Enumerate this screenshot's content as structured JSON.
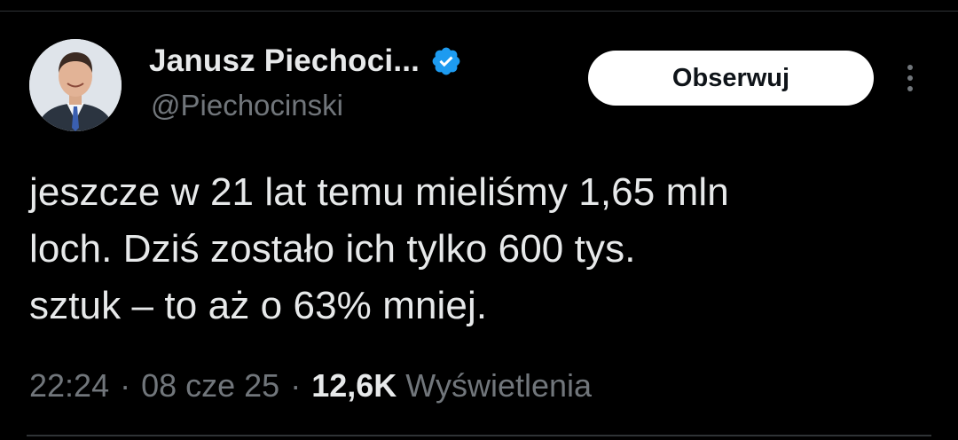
{
  "author": {
    "display_name": "Janusz Piechoci...",
    "handle": "@Piechocinski",
    "verified": true,
    "avatar_icon": "person-portrait-icon"
  },
  "actions": {
    "follow_label": "Obserwuj",
    "more_icon": "vertical-dots-icon"
  },
  "tweet": {
    "text": "jeszcze w 21 lat temu mieliśmy 1,65 mln\nloch. Dziś zostało ich tylko 600 tys.\nsztuk – to aż o 63% mniej."
  },
  "meta": {
    "time": "22:24",
    "separator": "·",
    "date": "08 cze 25",
    "views_count": "12,6K",
    "views_label": "Wyświetlenia"
  },
  "colors": {
    "background": "#000000",
    "text_primary": "#e7e9ea",
    "text_secondary": "#71767b",
    "verified_badge": "#1d9bf0",
    "follow_bg": "#ffffff"
  }
}
